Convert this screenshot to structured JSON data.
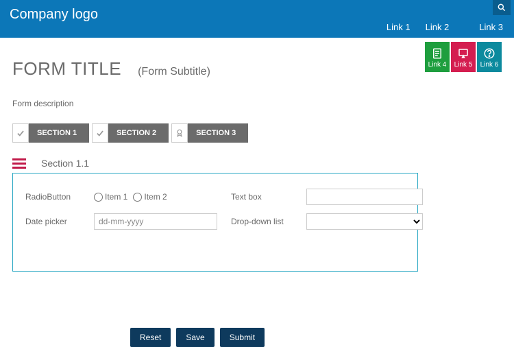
{
  "header": {
    "logo": "Company logo",
    "topLinks": [
      "Link 1",
      "Link 2",
      "Link 3"
    ]
  },
  "blockLinks": {
    "link4": "Link 4",
    "link5": "Link 5",
    "link6": "Link 6"
  },
  "form": {
    "title": "FORM TITLE",
    "subtitle": "(Form Subtitle)",
    "description": "Form description"
  },
  "sections": {
    "s1": "SECTION 1",
    "s2": "SECTION 2",
    "s3": "SECTION 3"
  },
  "subsection": {
    "title": "Section 1.1"
  },
  "fields": {
    "radio": {
      "label": "RadioButton",
      "opt1": "Item 1",
      "opt2": "Item 2"
    },
    "textbox": {
      "label": "Text box"
    },
    "datepicker": {
      "label": "Date picker",
      "placeholder": "dd-mm-yyyy"
    },
    "dropdown": {
      "label": "Drop-down list"
    }
  },
  "buttons": {
    "reset": "Reset",
    "save": "Save",
    "submit": "Submit"
  }
}
